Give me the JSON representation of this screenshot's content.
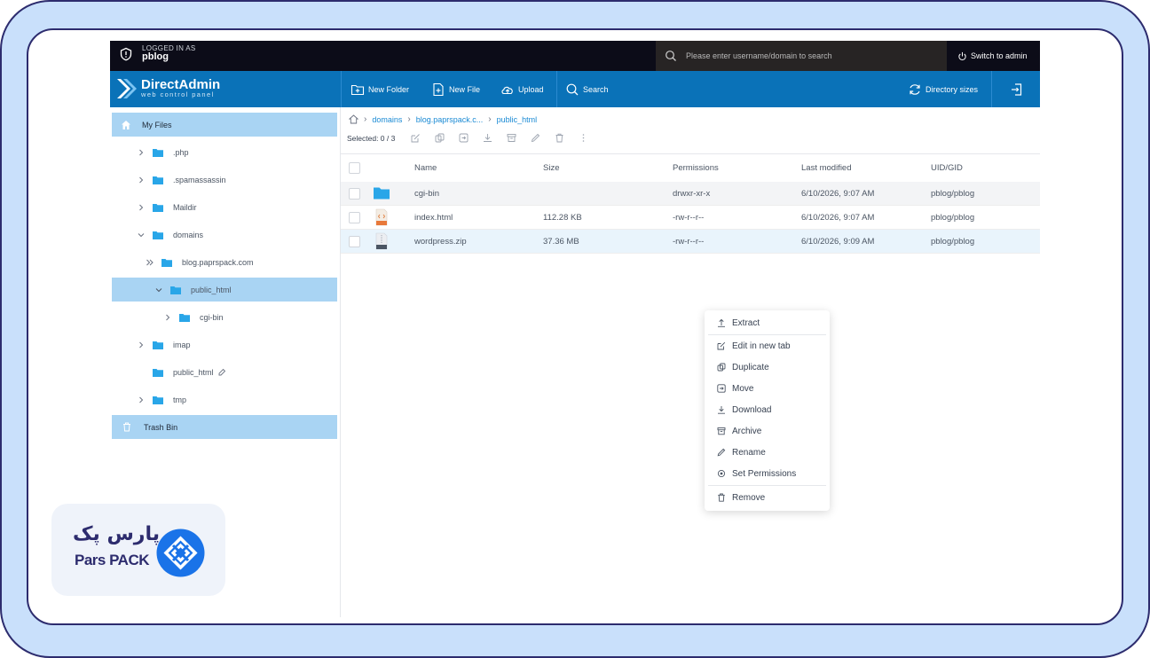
{
  "topbar": {
    "logged_in_caption": "LOGGED IN AS",
    "username": "pblog",
    "search_placeholder": "Please enter username/domain to search",
    "switch_admin": "Switch to admin"
  },
  "brand": {
    "title": "DirectAdmin",
    "subtitle": "web control panel"
  },
  "nav": {
    "new_folder": "New Folder",
    "new_file": "New File",
    "upload": "Upload",
    "search": "Search",
    "directory_sizes": "Directory sizes"
  },
  "sidebar": {
    "my_files": "My Files",
    "items": [
      {
        "label": ".php"
      },
      {
        "label": ".spamassassin"
      },
      {
        "label": "Maildir"
      },
      {
        "label": "domains"
      },
      {
        "label": "blog.paprspack.com"
      },
      {
        "label": "public_html"
      },
      {
        "label": "cgi-bin"
      },
      {
        "label": "imap"
      },
      {
        "label": "public_html"
      },
      {
        "label": "tmp"
      }
    ],
    "trash": "Trash Bin"
  },
  "breadcrumb": [
    "domains",
    "blog.paprspack.c...",
    "public_html"
  ],
  "selection": "Selected: 0 / 3",
  "table": {
    "headers": [
      "Name",
      "Size",
      "Permissions",
      "Last modified",
      "UID/GID"
    ],
    "rows": [
      {
        "name": "cgi-bin",
        "size": "",
        "perm": "drwxr-xr-x",
        "modified": "6/10/2026, 9:07 AM",
        "uid": "pblog/pblog",
        "type": "folder"
      },
      {
        "name": "index.html",
        "size": "112.28 KB",
        "perm": "-rw-r--r--",
        "modified": "6/10/2026, 9:07 AM",
        "uid": "pblog/pblog",
        "type": "html"
      },
      {
        "name": "wordpress.zip",
        "size": "37.36 MB",
        "perm": "-rw-r--r--",
        "modified": "6/10/2026, 9:09 AM",
        "uid": "pblog/pblog",
        "type": "zip"
      }
    ]
  },
  "context_menu": {
    "extract": "Extract",
    "edit_new_tab": "Edit in new tab",
    "duplicate": "Duplicate",
    "move": "Move",
    "download": "Download",
    "archive": "Archive",
    "rename": "Rename",
    "set_permissions": "Set Permissions",
    "remove": "Remove"
  },
  "watermark": {
    "persian": "پارس پک",
    "english": "Pars PACK"
  },
  "colors": {
    "nav_blue": "#0a72b8",
    "top_black": "#0c0c18",
    "active_row": "#a9d4f3",
    "frame_bg": "#c9e0fb",
    "frame_border": "#2d2c6e",
    "brand_blue": "#1a73e8"
  }
}
